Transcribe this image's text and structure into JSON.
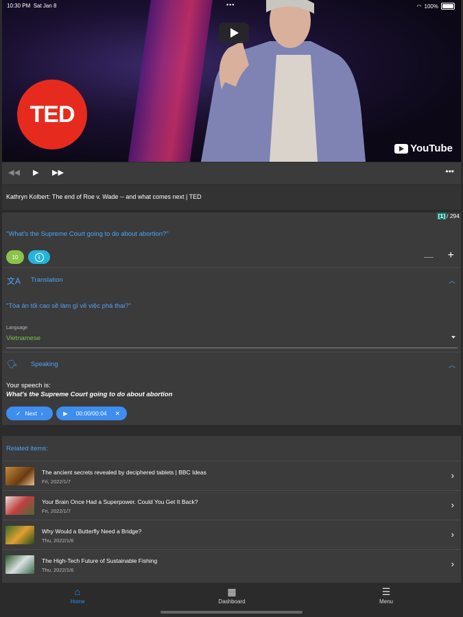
{
  "status_bar": {
    "time": "10:30 PM",
    "date": "Sat Jan 8",
    "battery": "100%"
  },
  "video": {
    "ted_logo": "TED",
    "youtube": "YouTube"
  },
  "player": {
    "title": "Kathryn Kolbert: The end of Roe v. Wade -- and what comes next | TED"
  },
  "lesson": {
    "counter_current": "[1]",
    "counter_total": "/ 294",
    "sentence": "\"What's the Supreme Court going to do about abortion?\"",
    "badge_count": "10",
    "translation_label": "Translation",
    "translation_text": "\"Tòa án tối cao sẽ làm gì về việc phá thai?\"",
    "language_label": "Language",
    "language_value": "Vietnamese",
    "speaking_label": "Speaking",
    "speech_label": "Your speech is:",
    "speech_value": "What's the Supreme Court going to do about abortion",
    "next_label": "Next",
    "audio_time": "00:00/00:04"
  },
  "related": {
    "heading": "Related items:",
    "items": [
      {
        "title": "The ancient secrets revealed by deciphered tablets | BBC Ideas",
        "date": "Fri, 2022/1/7"
      },
      {
        "title": "Your Brain Once Had a Superpower. Could You Get It Back?",
        "date": "Fri, 2022/1/7"
      },
      {
        "title": "Why Would a Butterfly Need a Bridge?",
        "date": "Thu, 2022/1/6"
      },
      {
        "title": "The High-Tech Future of Sustainable Fishing",
        "date": "Thu, 2022/1/6"
      }
    ]
  },
  "nav": {
    "home": "Home",
    "dashboard": "Dashboard",
    "menu": "Menu"
  },
  "colors": {
    "accent": "#4fa3f7",
    "home_active": "#2f8cf0",
    "language_green": "#7cc24b",
    "badge_green": "#8bc34a",
    "badge_cyan": "#26b3d9",
    "ted_red": "#e62b1e",
    "counter_teal": "#0e7d6b"
  }
}
